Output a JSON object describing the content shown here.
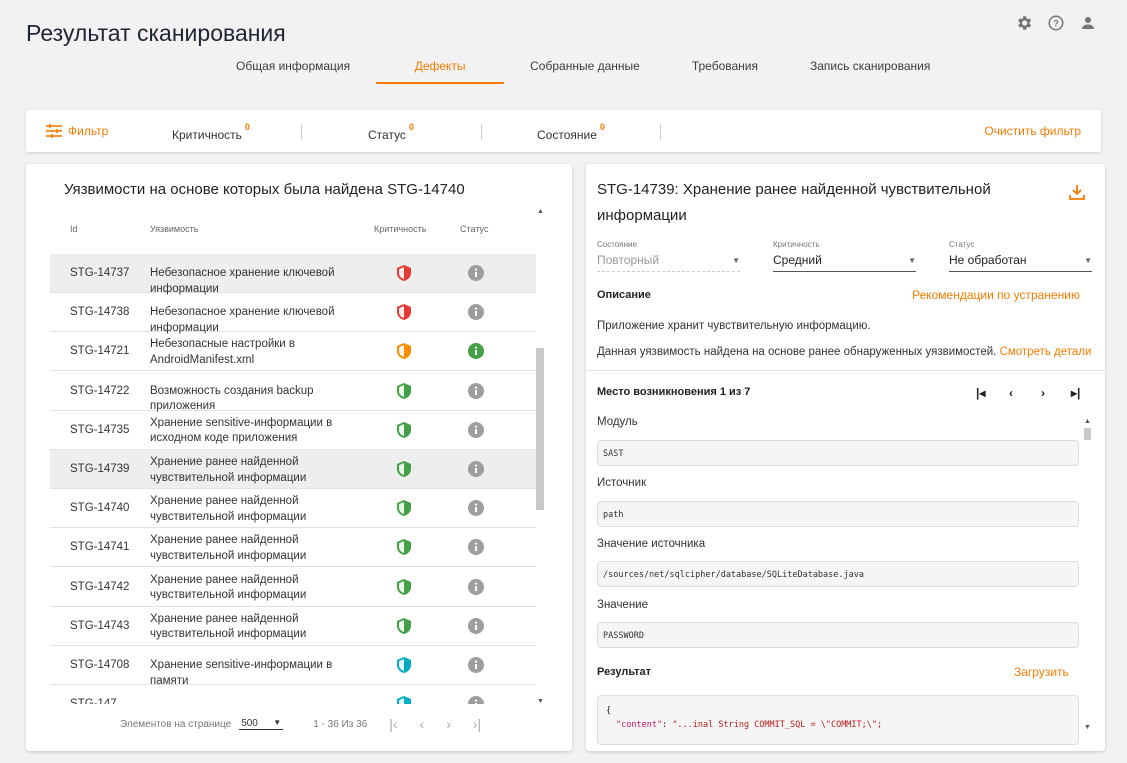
{
  "page_title": "Результат сканирования",
  "tabs": [
    "Общая информация",
    "Дефекты",
    "Собранные данные",
    "Требования",
    "Запись сканирования"
  ],
  "active_tab": "Дефекты",
  "filter": {
    "filter_label": "Фильтр",
    "criticality_label": "Критичность",
    "criticality_count": "0",
    "status_label": "Статус",
    "status_count": "0",
    "state_label": "Состояние",
    "state_count": "0",
    "clear_label": "Очистить фильтр"
  },
  "left": {
    "title": "Уязвимости на основе которых была найдена STG-14740",
    "columns": {
      "id": "Id",
      "vuln": "Уязвимость",
      "crit": "Критичность",
      "status": "Статус"
    },
    "rows": [
      {
        "id": "STG-14737",
        "name": "Небезопасное хранение ключевой информации",
        "crit": "high",
        "status": "grey",
        "selected": true
      },
      {
        "id": "STG-14738",
        "name": "Небезопасное хранение ключевой информации",
        "crit": "high",
        "status": "grey",
        "selected": false
      },
      {
        "id": "STG-14721",
        "name": "Небезопасные настройки в AndroidManifest.xml",
        "crit": "medium",
        "status": "green",
        "selected": false
      },
      {
        "id": "STG-14722",
        "name": "Возможность создания backup приложения",
        "crit": "low",
        "status": "grey",
        "selected": false
      },
      {
        "id": "STG-14735",
        "name": "Хранение sensitive-информации в исходном коде приложения",
        "crit": "low",
        "status": "grey",
        "selected": false
      },
      {
        "id": "STG-14739",
        "name": "Хранение ранее найденной чувствительной информации",
        "crit": "low",
        "status": "grey",
        "selected": true
      },
      {
        "id": "STG-14740",
        "name": "Хранение ранее найденной чувствительной информации",
        "crit": "low",
        "status": "grey",
        "selected": false
      },
      {
        "id": "STG-14741",
        "name": "Хранение ранее найденной чувствительной информации",
        "crit": "low",
        "status": "grey",
        "selected": false
      },
      {
        "id": "STG-14742",
        "name": "Хранение ранее найденной чувствительной информации",
        "crit": "low",
        "status": "grey",
        "selected": false
      },
      {
        "id": "STG-14743",
        "name": "Хранение ранее найденной чувствительной информации",
        "crit": "low",
        "status": "grey",
        "selected": false
      },
      {
        "id": "STG-14708",
        "name": "Хранение sensitive-информации в памяти",
        "crit": "info",
        "status": "grey",
        "selected": false
      },
      {
        "id": "STG-147",
        "name": "",
        "crit": "info",
        "status": "grey",
        "selected": false
      }
    ],
    "pager": {
      "label": "Элементов на странице",
      "size": "500",
      "range": "1 - 36 Из 36"
    }
  },
  "right": {
    "title": "STG-14739: Хранение ранее найденной чувствительной информации",
    "state": {
      "label": "Состояние",
      "value": "Повторный"
    },
    "criticality": {
      "label": "Критичность",
      "value": "Средний"
    },
    "status": {
      "label": "Статус",
      "value": "Не обработан"
    },
    "description_label": "Описание",
    "recommendations_link": "Рекомендации по устранению",
    "desc_text": "Приложение хранит чувствительную информацию.",
    "desc_text2": "Данная уязвимость найдена на основе ранее обнаруженных уязвимостей.",
    "details_link": "Смотреть детали",
    "occurrence": "Место возникновения 1 из 7",
    "module_label": "Модуль",
    "module_value": "SAST",
    "source_label": "Источник",
    "source_value": "path",
    "source_value_label": "Значение источника",
    "source_value_value": "/sources/net/sqlcipher/database/SQLiteDatabase.java",
    "value_label": "Значение",
    "value_value": "PASSWORD",
    "result_label": "Результат",
    "load_label": "Загрузить",
    "code_line1": "{",
    "code_key": "\"content\"",
    "code_value": "\"...inal String COMMIT_SQL = \\\"COMMIT;\\\";"
  },
  "colors": {
    "accent": "#f57c00",
    "high": "#e53935",
    "medium": "#fb8c00",
    "low": "#43a047",
    "info": "#00acc1",
    "ok": "#43a047",
    "grey": "#9e9e9e"
  }
}
